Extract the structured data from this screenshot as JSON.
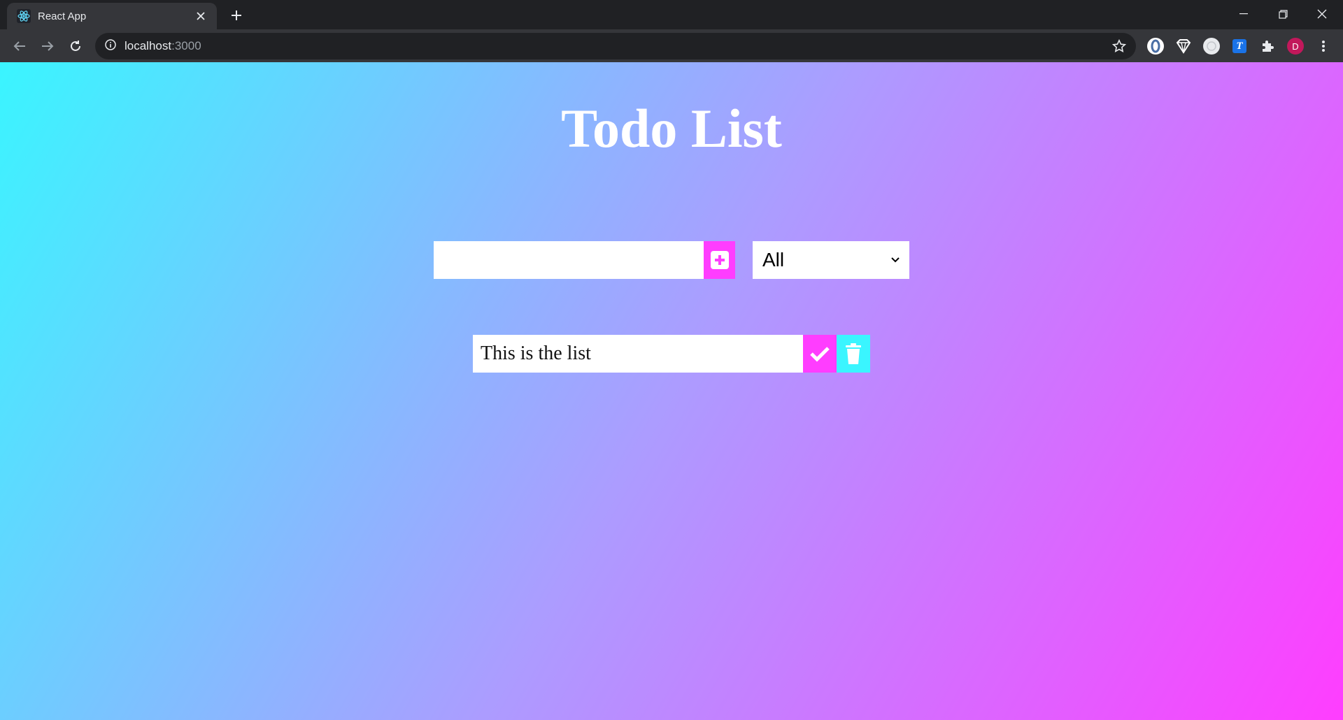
{
  "browser": {
    "tab": {
      "title": "React App",
      "favicon": "react-icon"
    },
    "address": {
      "host": "localhost",
      "port": ":3000"
    },
    "extensions": [
      "opera-icon",
      "shield-icon",
      "circle-icon",
      "T",
      "puzzle-icon"
    ],
    "profile_initial": "D"
  },
  "app": {
    "title": "Todo List",
    "input": {
      "value": "",
      "placeholder": ""
    },
    "filter": {
      "selected": "All"
    },
    "todos": [
      {
        "text": "This is the list"
      }
    ],
    "colors": {
      "accent_pink": "#ff3dff",
      "accent_cyan": "#3af5ff",
      "gradient_mid": "#ac9cff"
    }
  }
}
